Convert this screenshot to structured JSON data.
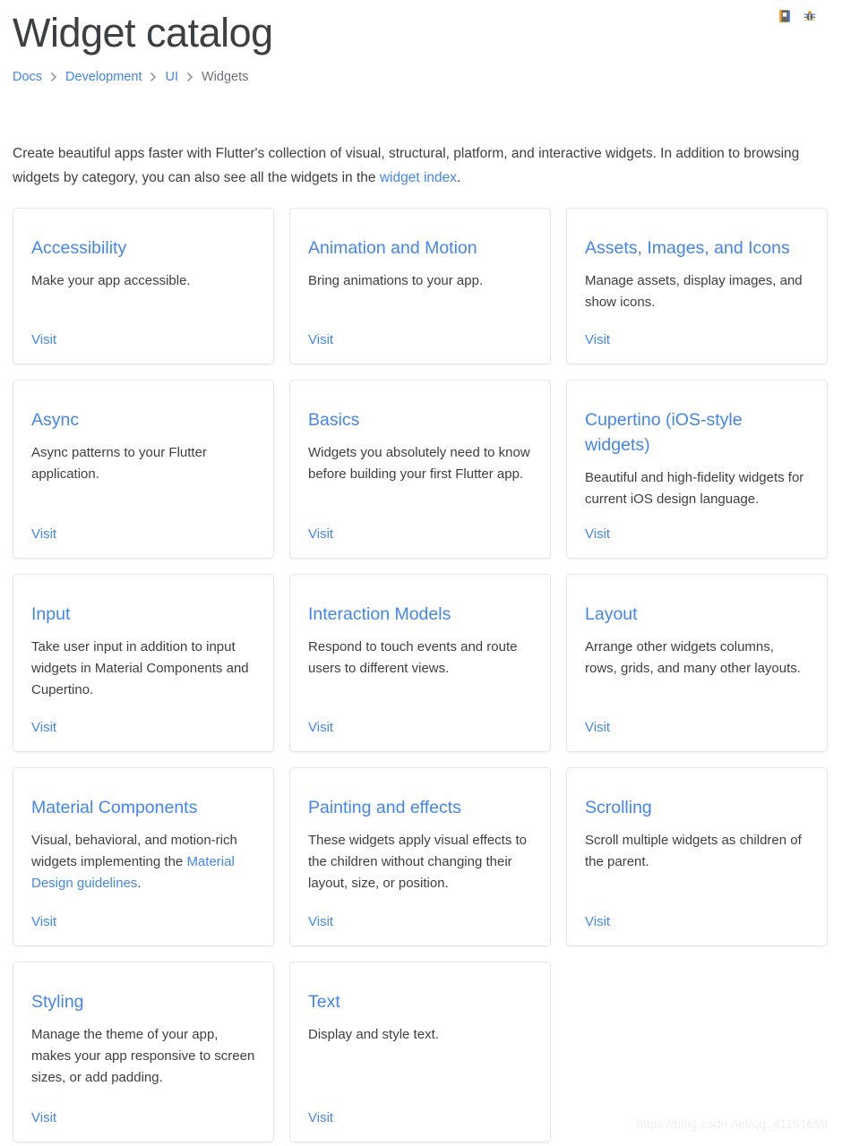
{
  "header": {
    "title": "Widget catalog",
    "actions": [
      {
        "name": "report-doc-issue-icon",
        "icon": "document-icon",
        "label": ""
      },
      {
        "name": "report-bug-icon",
        "icon": "bug-icon",
        "label": ""
      }
    ]
  },
  "breadcrumb": {
    "items": [
      {
        "label": "Docs",
        "current": false
      },
      {
        "label": "Development",
        "current": false
      },
      {
        "label": "UI",
        "current": false
      },
      {
        "label": "Widgets",
        "current": true
      }
    ],
    "separator_icon": "chevron-right-icon"
  },
  "intro": {
    "text_before": "Create beautiful apps faster with Flutter's collection of visual, structural, platform, and interactive widgets. In addition to browsing widgets by category, you can also see all the widgets in the ",
    "link_label": "widget index",
    "text_after": "."
  },
  "cards": {
    "visit_label": "Visit",
    "items": [
      {
        "title": "Accessibility",
        "description": "Make your app accessible.",
        "visit": "Visit"
      },
      {
        "title": "Animation and Motion",
        "description": "Bring animations to your app.",
        "visit": "Visit"
      },
      {
        "title": "Assets, Images, and Icons",
        "description": "Manage assets, display images, and show icons.",
        "visit": "Visit"
      },
      {
        "title": "Async",
        "description": "Async patterns to your Flutter application.",
        "visit": "Visit"
      },
      {
        "title": "Basics",
        "description": "Widgets you absolutely need to know before building your first Flutter app.",
        "visit": "Visit"
      },
      {
        "title": "Cupertino (iOS-style widgets)",
        "description": "Beautiful and high-fidelity widgets for current iOS design language.",
        "visit": "Visit"
      },
      {
        "title": "Input",
        "description": "Take user input in addition to input widgets in Material Components and Cupertino.",
        "visit": "Visit"
      },
      {
        "title": "Interaction Models",
        "description": "Respond to touch events and route users to different views.",
        "visit": "Visit"
      },
      {
        "title": "Layout",
        "description": "Arrange other widgets columns, rows, grids, and many other layouts.",
        "visit": "Visit"
      },
      {
        "title": "Material Components",
        "description_before": "Visual, behavioral, and motion-rich widgets implementing the ",
        "description_link": "Material Design guidelines",
        "description_after": ".",
        "visit": "Visit"
      },
      {
        "title": "Painting and effects",
        "description": "These widgets apply visual effects to the children without changing their layout, size, or position.",
        "visit": "Visit"
      },
      {
        "title": "Scrolling",
        "description": "Scroll multiple widgets as children of the parent.",
        "visit": "Visit"
      },
      {
        "title": "Styling",
        "description": "Manage the theme of your app, makes your app responsive to screen sizes, or add padding.",
        "visit": "Visit"
      },
      {
        "title": "Text",
        "description": "Display and style text.",
        "visit": "Visit"
      }
    ]
  },
  "watermark": {
    "text": "https://blog.csdn.net/qq_41151659"
  },
  "colors": {
    "link": "#4285f4",
    "text": "#3c4043",
    "muted": "#6c7279",
    "card_border": "#e4e6e8",
    "background": "#ffffff"
  }
}
